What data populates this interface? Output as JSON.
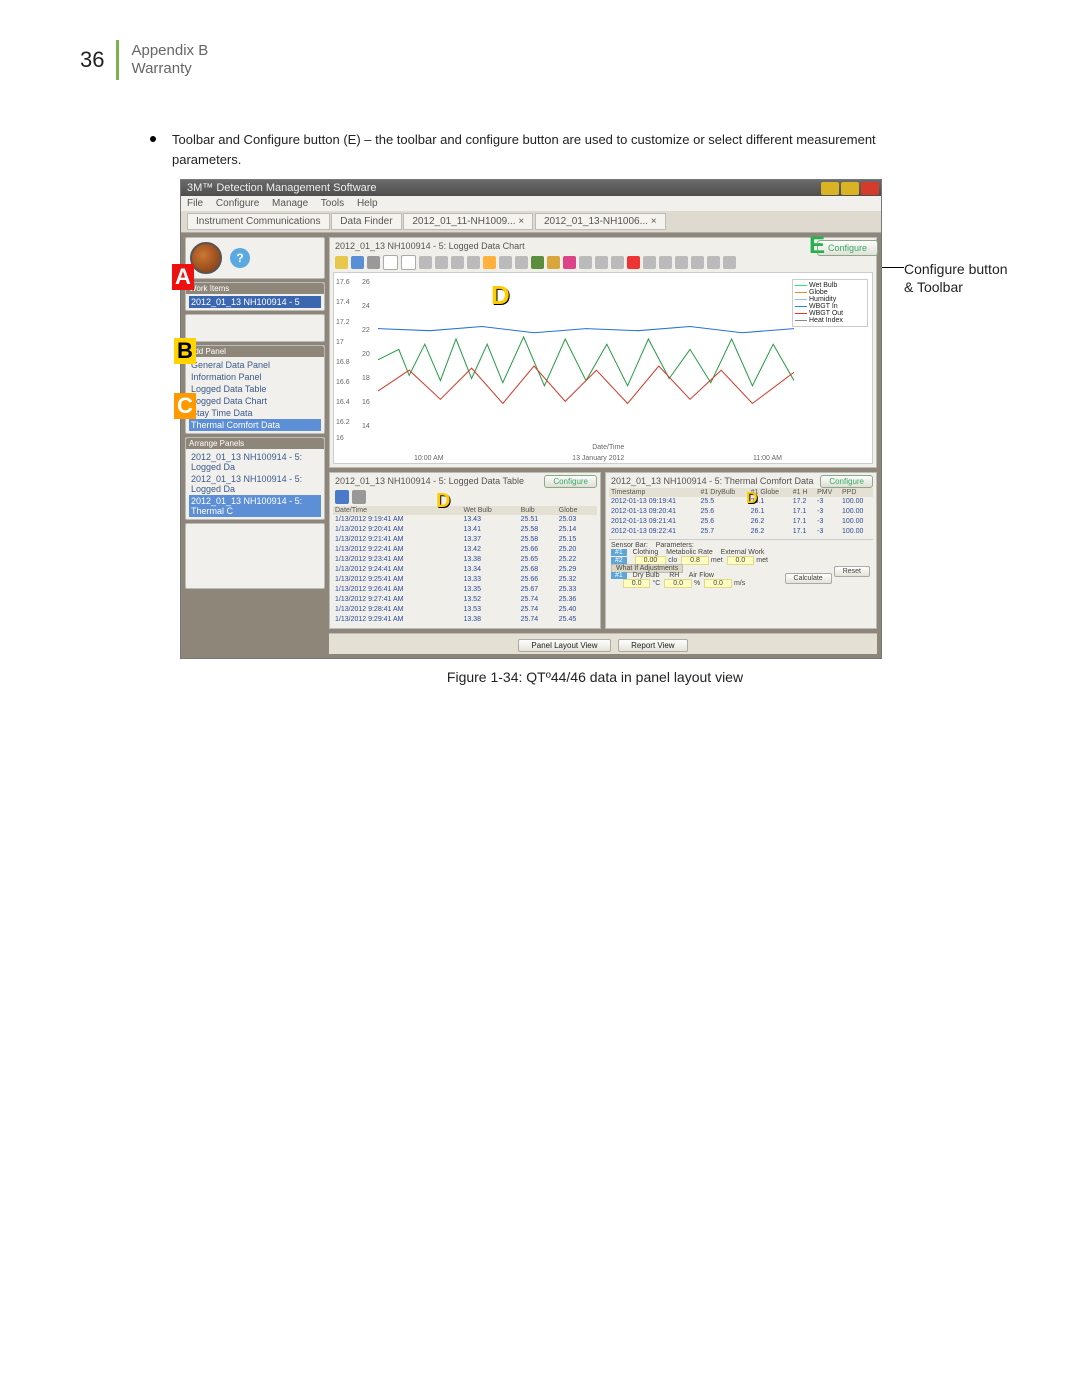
{
  "page_number": "36",
  "header": {
    "line1": "Appendix B",
    "line2": "Warranty"
  },
  "bullet": {
    "lead": "Toolbar and Configure button",
    "paren": "(E)",
    "rest": " – the toolbar and configure button are used to customize or select different measurement parameters."
  },
  "callout": {
    "l1": "Configure button",
    "l2": "& Toolbar"
  },
  "app": {
    "title": "3M™ Detection Management Software",
    "menus": [
      "File",
      "Configure",
      "Manage",
      "Tools",
      "Help"
    ],
    "tabs": [
      "Instrument Communications",
      "Data Finder",
      "2012_01_11-NH1009...  ×",
      "2012_01_13-NH1006...  ×"
    ],
    "panel_chart_title": "2012_01_13 NH100914 - 5: Logged Data Chart",
    "configure": "Configure",
    "chart_x_center": "Date/Time",
    "chart_x_sub": "13 January 2012",
    "chart_x_left": "10:00 AM",
    "chart_x_right": "11:00 AM",
    "y_left": [
      "17.6",
      "17.4",
      "17.2",
      "17",
      "16.8",
      "16.6",
      "16.4",
      "16.2",
      "16"
    ],
    "y_left2": [
      "26",
      "24",
      "22",
      "20",
      "18",
      "16",
      "14"
    ],
    "legend": [
      "Wet Bulb",
      "Globe",
      "Humidity",
      "WBGT In",
      "WBGT Out",
      "Heat Index"
    ],
    "side": {
      "work_items": "Work Items",
      "wi1": "2012_01_13 NH100914 - 5",
      "add_panel": "Add Panel",
      "panels": [
        "General Data Panel",
        "Information Panel",
        "Logged Data Table",
        "Logged Data Chart",
        "Stay Time Data",
        "Thermal Comfort Data"
      ],
      "arrange": "Arrange Panels",
      "ar_items": [
        "2012_01_13 NH100914 - 5: Logged Da",
        "2012_01_13 NH100914 - 5: Logged Da",
        "2012_01_13 NH100914 - 5: Thermal C"
      ]
    },
    "table_panel_title": "2012_01_13 NH100914 - 5: Logged Data Table",
    "comfort_panel_title": "2012_01_13 NH100914 - 5: Thermal Comfort Data",
    "tbl_cols": [
      "Date/Time",
      "Wet Bulb",
      "Bulb",
      "Globe"
    ],
    "tbl_rows": [
      [
        "1/13/2012 9:19:41 AM",
        "13.43",
        "25.51",
        "25.03"
      ],
      [
        "1/13/2012 9:20:41 AM",
        "13.41",
        "25.58",
        "25.14"
      ],
      [
        "1/13/2012 9:21:41 AM",
        "13.37",
        "25.58",
        "25.15"
      ],
      [
        "1/13/2012 9:22:41 AM",
        "13.42",
        "25.66",
        "25.20"
      ],
      [
        "1/13/2012 9:23:41 AM",
        "13.38",
        "25.65",
        "25.22"
      ],
      [
        "1/13/2012 9:24:41 AM",
        "13.34",
        "25.68",
        "25.29"
      ],
      [
        "1/13/2012 9:25:41 AM",
        "13.33",
        "25.66",
        "25.32"
      ],
      [
        "1/13/2012 9:26:41 AM",
        "13.35",
        "25.67",
        "25.33"
      ],
      [
        "1/13/2012 9:27:41 AM",
        "13.52",
        "25.74",
        "25.36"
      ],
      [
        "1/13/2012 9:28:41 AM",
        "13.53",
        "25.74",
        "25.40"
      ],
      [
        "1/13/2012 9:29:41 AM",
        "13.38",
        "25.74",
        "25.45"
      ]
    ],
    "cf_cols": [
      "Timestamp",
      "#1 DryBulb",
      "#1 Globe",
      "#1 H",
      "PMV",
      "PPD"
    ],
    "cf_rows": [
      [
        "2012-01-13 09:19:41",
        "25.5",
        "26.1",
        "17.2",
        "-3",
        "100.00"
      ],
      [
        "2012-01-13 09:20:41",
        "25.6",
        "26.1",
        "17.1",
        "-3",
        "100.00"
      ],
      [
        "2012-01-13 09:21:41",
        "25.6",
        "26.2",
        "17.1",
        "-3",
        "100.00"
      ],
      [
        "2012-01-13 09:22:41",
        "25.7",
        "26.2",
        "17.1",
        "-3",
        "100.00"
      ]
    ],
    "sensorbar": "Sensor Bar:",
    "params": "Parameters:",
    "sb1": "#1",
    "clothing": "Clothing",
    "met": "Metabolic Rate",
    "ext": "External Work",
    "v0": "0.00",
    "u0": "clo",
    "v1": "0.8",
    "u1": "met",
    "v2": "0.0",
    "u2": "met",
    "whatif": "What If Adjustments",
    "dry": "Dry Bulb",
    "rh": "RH",
    "air": "Air Flow",
    "f0": "0.0",
    "uC": "°C",
    "f1": "0.0",
    "uP": "%",
    "f2": "0.0",
    "uM": "m/s",
    "reset": "Reset",
    "calc": "Calculate",
    "bot1": "Panel Layout View",
    "bot2": "Report View"
  },
  "markers": {
    "A": "A",
    "B": "B",
    "C": "C",
    "D": "D",
    "E": "E"
  },
  "caption": "Figure 1-34:  QTº44/46 data in panel layout view"
}
